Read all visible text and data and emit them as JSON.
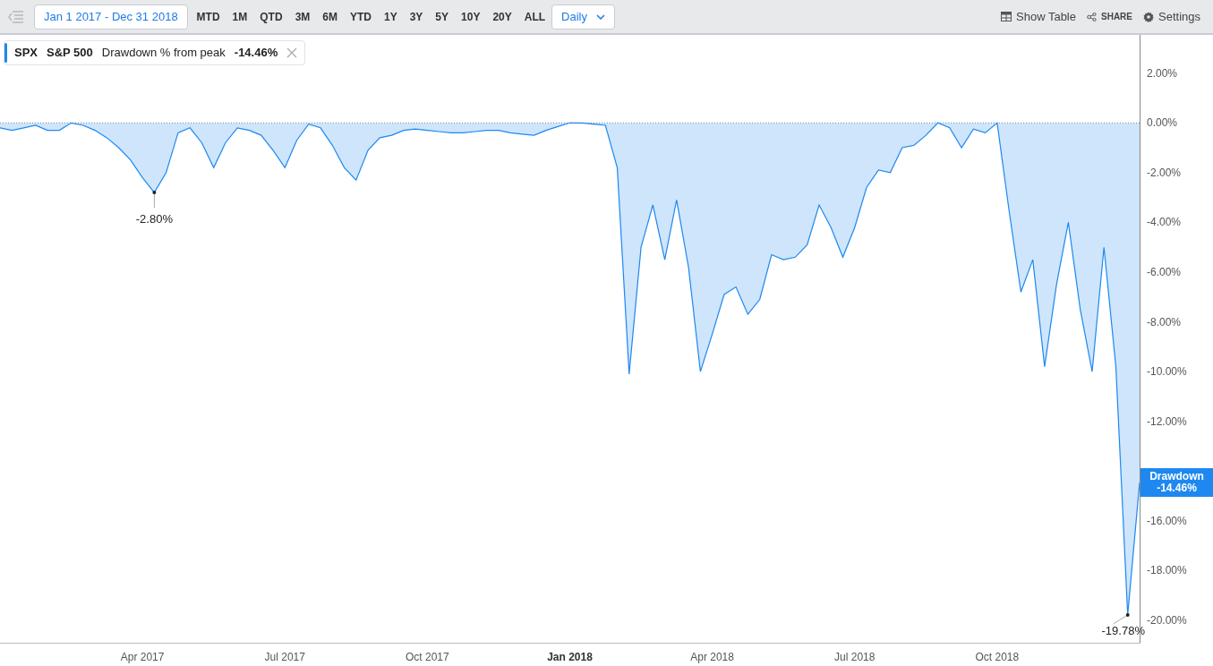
{
  "toolbar": {
    "menu": {
      "disabled": true
    },
    "date_range": "Jan 1 2017 - Dec 31 2018",
    "periods": [
      "MTD",
      "1M",
      "QTD",
      "3M",
      "6M",
      "YTD",
      "1Y",
      "3Y",
      "5Y",
      "10Y",
      "20Y",
      "ALL"
    ],
    "interval": "Daily",
    "actions": [
      {
        "kind": "table",
        "label": "Show Table"
      },
      {
        "kind": "share",
        "label": "SHARE"
      },
      {
        "kind": "settings",
        "label": "Settings"
      }
    ]
  },
  "legend": {
    "symbol": "SPX",
    "name": "S&P 500",
    "metric": "Drawdown % from peak",
    "value": "-14.46%",
    "color": "#1e88f0"
  },
  "badge": {
    "value": "-14.46%"
  },
  "chart_data": {
    "type": "area",
    "ylim": [
      -20.9,
      3.5
    ],
    "categories": [
      null,
      null,
      null,
      null,
      null,
      null,
      null,
      null,
      null,
      null,
      null,
      null,
      "Apr 2017",
      null,
      null,
      null,
      null,
      null,
      null,
      null,
      null,
      null,
      null,
      null,
      "Jul 2017",
      null,
      null,
      null,
      null,
      null,
      null,
      null,
      null,
      null,
      null,
      null,
      "Oct 2017",
      null,
      null,
      null,
      null,
      null,
      null,
      null,
      null,
      null,
      null,
      null,
      "Jan 2018",
      null,
      null,
      null,
      null,
      null,
      null,
      null,
      null,
      null,
      null,
      null,
      "Apr 2018",
      null,
      null,
      null,
      null,
      null,
      null,
      null,
      null,
      null,
      null,
      null,
      "Jul 2018",
      null,
      null,
      null,
      null,
      null,
      null,
      null,
      null,
      null,
      null,
      null,
      "Oct 2018",
      null,
      null,
      null,
      null,
      null,
      null,
      null,
      null,
      null,
      null,
      null,
      null
    ],
    "yticks": [
      {
        "value": 2,
        "label": "2.00%"
      },
      {
        "value": 0,
        "label": "0.00%"
      },
      {
        "value": -2,
        "label": "-2.00%"
      },
      {
        "value": -4,
        "label": "-4.00%"
      },
      {
        "value": -6,
        "label": "-6.00%"
      },
      {
        "value": -8,
        "label": "-8.00%"
      },
      {
        "value": -10,
        "label": "-10.00%"
      },
      {
        "value": -12,
        "label": "-12.00%"
      },
      {
        "value": -16,
        "label": "-16.00%"
      },
      {
        "value": -18,
        "label": "-18.00%"
      },
      {
        "value": -20,
        "label": "-20.00%"
      }
    ],
    "series": [
      {
        "name": "Drawdown",
        "color": "#1e88f0",
        "values": [
          -0.2,
          -0.3,
          -0.2,
          -0.1,
          -0.3,
          -0.3,
          0,
          -0.1,
          -0.3,
          -0.6,
          -1.0,
          -1.5,
          -2.2,
          -2.8,
          -2.0,
          -0.4,
          -0.2,
          -0.8,
          -1.8,
          -0.8,
          -0.2,
          -0.3,
          -0.5,
          -1.1,
          -1.8,
          -0.7,
          -0.05,
          -0.2,
          -0.9,
          -1.8,
          -2.3,
          -1.1,
          -0.6,
          -0.5,
          -0.3,
          -0.25,
          -0.3,
          -0.35,
          -0.4,
          -0.4,
          -0.35,
          -0.3,
          -0.3,
          -0.4,
          -0.45,
          -0.5,
          -0.3,
          -0.15,
          0,
          0,
          -0.05,
          -0.1,
          -1.8,
          -10.1,
          -5,
          -3.3,
          -5.5,
          -3.1,
          -5.8,
          -10.0,
          -8.5,
          -6.9,
          -6.6,
          -7.7,
          -7.1,
          -5.3,
          -5.5,
          -5.4,
          -4.9,
          -3.3,
          -4.2,
          -5.4,
          -4.2,
          -2.6,
          -1.9,
          -2.0,
          -1.0,
          -0.9,
          -0.5,
          0,
          -0.2,
          -1.0,
          -0.25,
          -0.4,
          0,
          -3.5,
          -6.8,
          -5.5,
          -9.8,
          -6.5,
          -4.0,
          -7.5,
          -10.0,
          -5.0,
          -9.8,
          -19.78,
          -14.46
        ]
      }
    ],
    "annotations": [
      {
        "y": -2.8,
        "text": "-2.80%"
      },
      {
        "y": -19.78,
        "text": "-19.78%"
      }
    ]
  }
}
